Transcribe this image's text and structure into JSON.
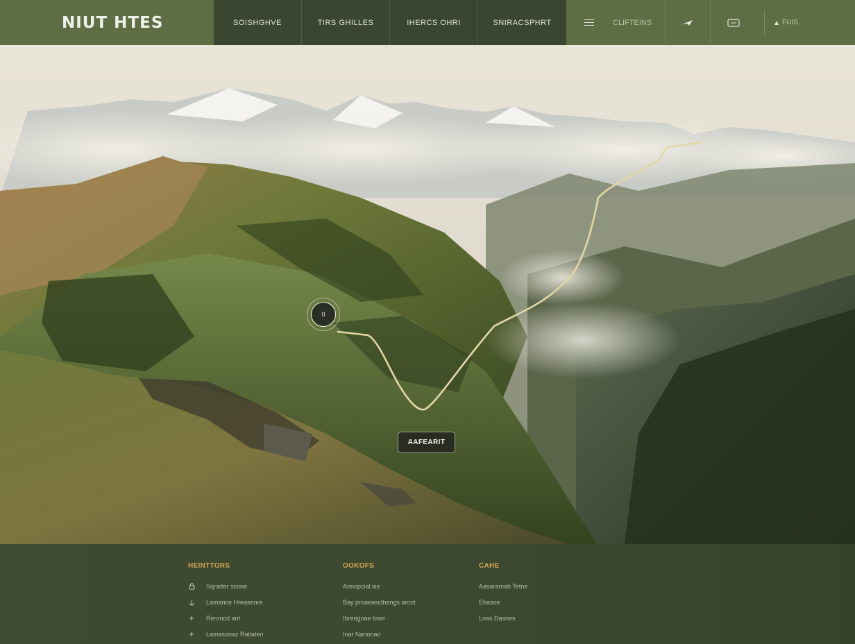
{
  "brand": {
    "title": "NIUT HTES"
  },
  "nav": {
    "tabs": [
      {
        "label": "SOISHGHVE"
      },
      {
        "label": "TIRS GHILLES"
      },
      {
        "label": "IHERCS OHRI"
      },
      {
        "label": "SNIRACSPHRT"
      }
    ]
  },
  "tools": {
    "menu_label": "CLIFTEINS",
    "language_label": "FUIS"
  },
  "hero": {
    "marker_label": "0",
    "cta_label": "AAFEARIT"
  },
  "footer": {
    "columns": [
      {
        "heading": "HEINTTORS",
        "items": [
          {
            "label": "Sqrarter scone"
          },
          {
            "label": "Lamance Hreasenre"
          },
          {
            "label": "Reroncd ant"
          },
          {
            "label": "Lamasonaz Ratlaten"
          }
        ]
      },
      {
        "heading": "OOKOFS",
        "items": [
          {
            "label": "Annopcial.sie"
          },
          {
            "label": "Bay proaeascthengs arcnt"
          },
          {
            "label": "Ibrengnae bner"
          },
          {
            "label": "Inar Nanonao"
          }
        ]
      },
      {
        "heading": "CAHE",
        "items": [
          {
            "label": "Aasaramah Tetne"
          },
          {
            "label": "Ehasoe"
          },
          {
            "label": "Lnas Dasnes"
          }
        ]
      }
    ]
  },
  "colors": {
    "header_bg": "#5d6e44",
    "nav_tab_bg": "#3a4630",
    "footer_bg": "#3d4a31",
    "footer_heading": "#d4a755",
    "route_line": "#e3d7a6"
  }
}
